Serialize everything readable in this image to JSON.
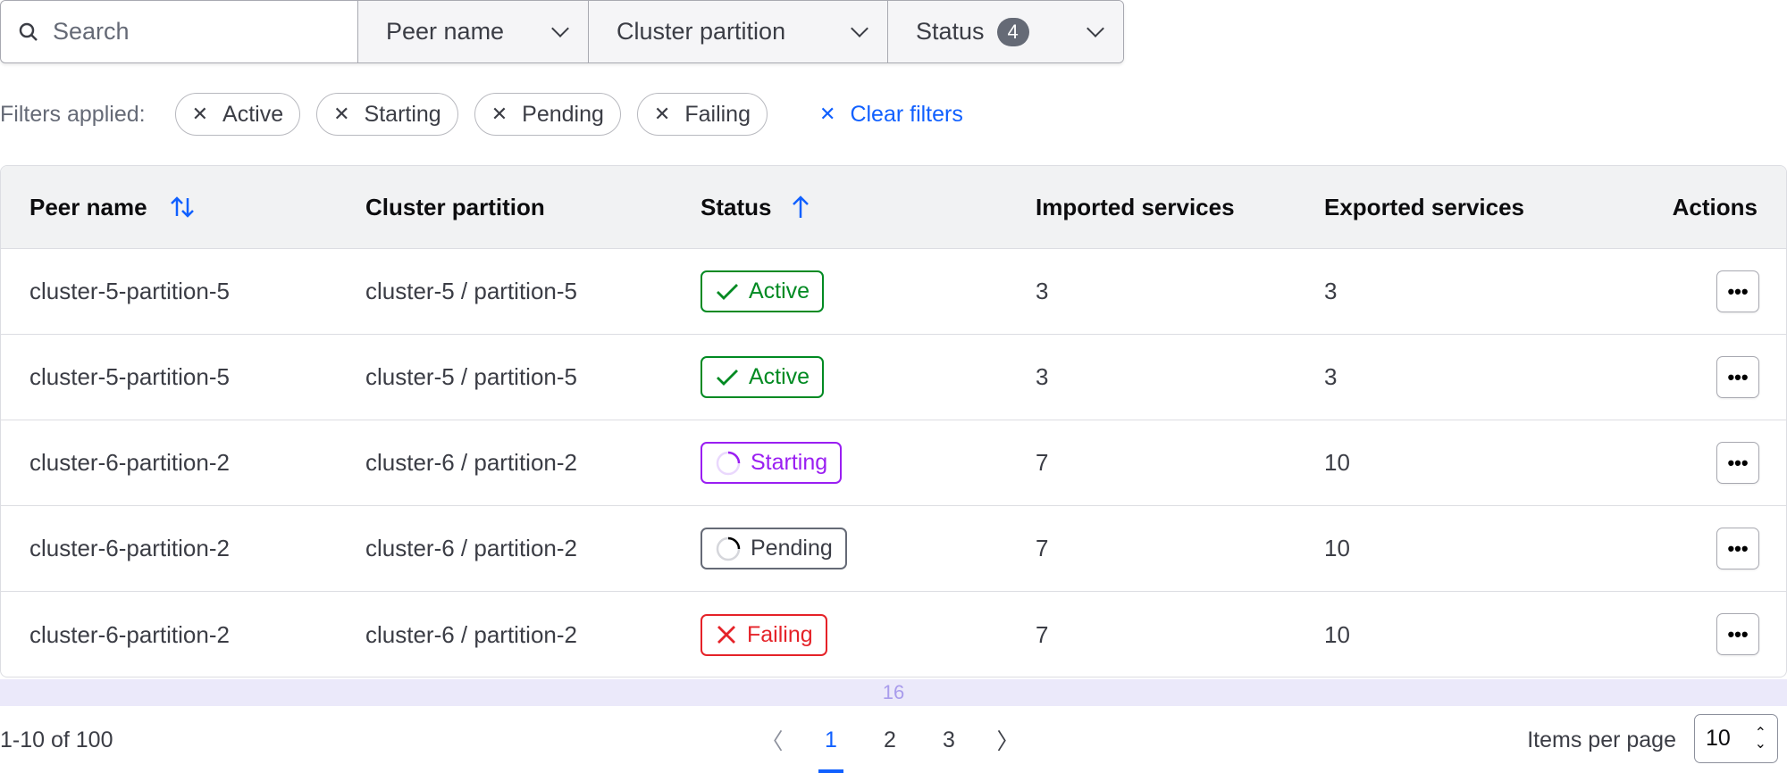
{
  "filters": {
    "search_placeholder": "Search",
    "peer_name": "Peer name",
    "cluster_partition": "Cluster partition",
    "status": "Status",
    "status_count": "4"
  },
  "applied": {
    "label": "Filters applied:",
    "chips": [
      "Active",
      "Starting",
      "Pending",
      "Failing"
    ],
    "clear": "Clear filters"
  },
  "table": {
    "headers": {
      "peer": "Peer name",
      "cluster": "Cluster partition",
      "status": "Status",
      "imported": "Imported services",
      "exported": "Exported services",
      "actions": "Actions"
    },
    "rows": [
      {
        "peer": "cluster-5-partition-5",
        "cluster": "cluster-5 / partition-5",
        "status": "Active",
        "imported": "3",
        "exported": "3"
      },
      {
        "peer": "cluster-5-partition-5",
        "cluster": "cluster-5 / partition-5",
        "status": "Active",
        "imported": "3",
        "exported": "3"
      },
      {
        "peer": "cluster-6-partition-2",
        "cluster": "cluster-6 / partition-2",
        "status": "Starting",
        "imported": "7",
        "exported": "10"
      },
      {
        "peer": "cluster-6-partition-2",
        "cluster": "cluster-6 / partition-2",
        "status": "Pending",
        "imported": "7",
        "exported": "10"
      },
      {
        "peer": "cluster-6-partition-2",
        "cluster": "cluster-6 / partition-2",
        "status": "Failing",
        "imported": "7",
        "exported": "10"
      }
    ]
  },
  "overlay": "16",
  "pagination": {
    "summary": "1-10 of 100",
    "pages": [
      "1",
      "2",
      "3"
    ],
    "current": "1",
    "items_per_page_label": "Items per page",
    "items_per_page": "10"
  },
  "colors": {
    "accent": "#1060ff",
    "active": "#008a22",
    "starting": "#9a1ef2",
    "pending": "#656a76",
    "failing": "#e52228"
  }
}
